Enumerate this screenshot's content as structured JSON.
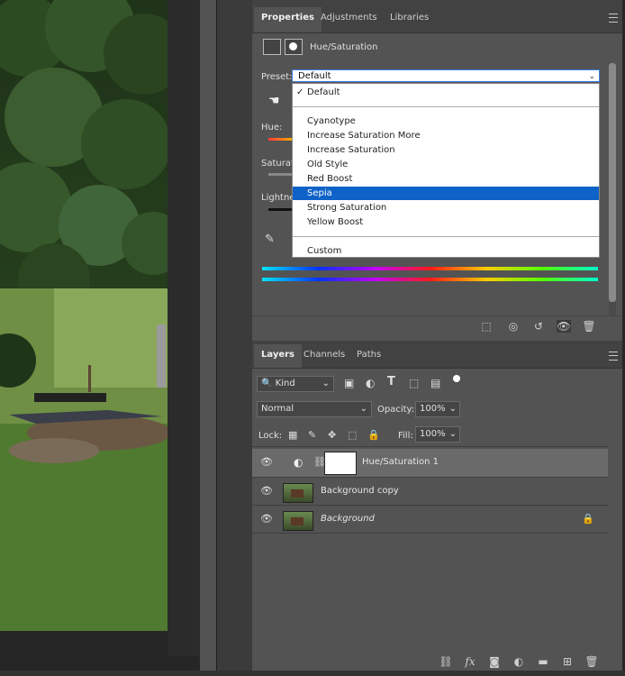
{
  "properties": {
    "tabs": [
      "Properties",
      "Adjustments",
      "Libraries"
    ],
    "adjustment_title": "Hue/Saturation",
    "preset_label": "Preset:",
    "preset_value": "Default",
    "options": [
      "Default",
      "Cyanotype",
      "Increase Saturation More",
      "Increase Saturation",
      "Old Style",
      "Red Boost",
      "Sepia",
      "Strong Saturation",
      "Yellow Boost",
      "Custom"
    ],
    "hovered_option": "Sepia",
    "checked_option": "Default",
    "hue_label": "Hue:",
    "saturation_label": "Saturati",
    "lightness_label": "Lightne"
  },
  "layers": {
    "tabs": [
      "Layers",
      "Channels",
      "Paths"
    ],
    "kind_label": "Kind",
    "blend_mode": "Normal",
    "opacity_label": "Opacity:",
    "opacity_value": "100%",
    "lock_label": "Lock:",
    "fill_label": "Fill:",
    "fill_value": "100%",
    "items": [
      {
        "name": "Hue/Saturation 1"
      },
      {
        "name": "Background copy"
      },
      {
        "name": "Background"
      }
    ]
  },
  "colors": {
    "selection": "#0e62c8",
    "annotation_arrow": "#f5f51e"
  }
}
